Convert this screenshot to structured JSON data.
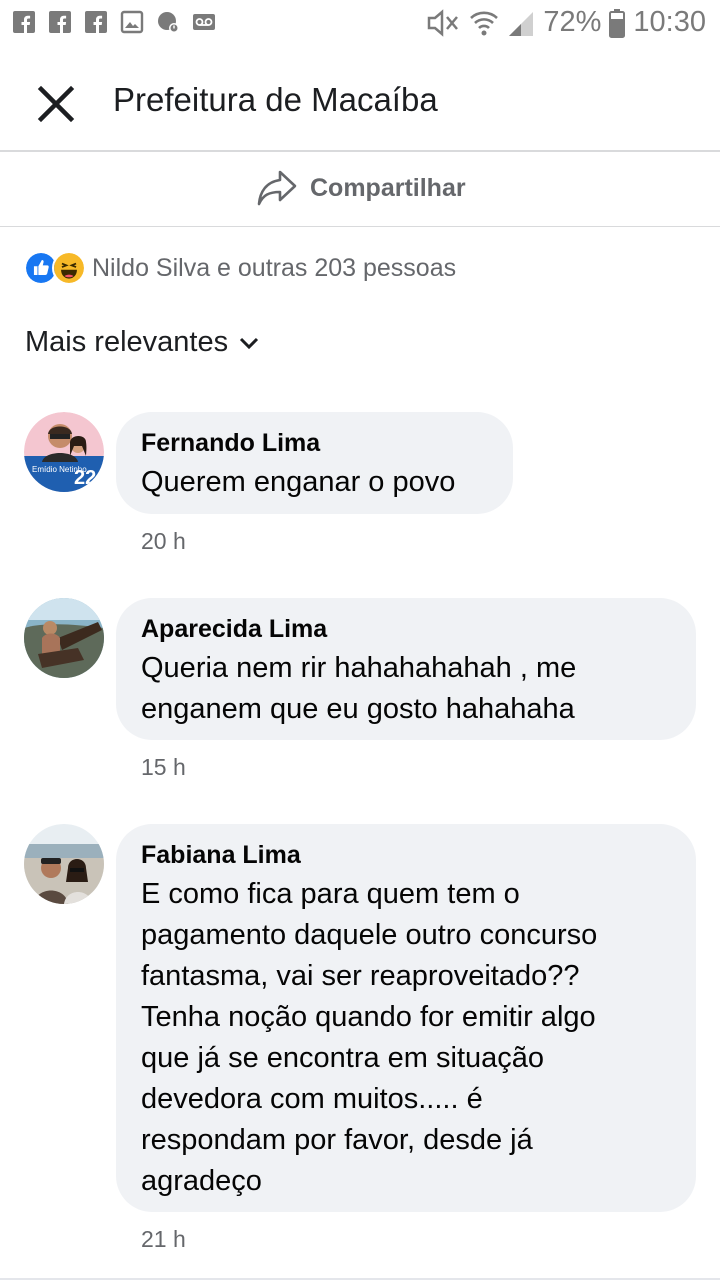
{
  "status_bar": {
    "battery": "72%",
    "time": "10:30",
    "left_icons": [
      "facebook-icon",
      "facebook-icon",
      "facebook-icon",
      "image-icon",
      "location-icon",
      "voicemail-icon"
    ],
    "right_icons": [
      "mute-icon",
      "wifi-icon",
      "signal-icon",
      "battery-icon"
    ]
  },
  "header": {
    "title": "Prefeitura de Macaíba",
    "close_icon": "close-icon"
  },
  "share": {
    "label": "Compartilhar",
    "icon": "share-icon"
  },
  "reactions": {
    "icons": [
      "like-icon",
      "haha-icon"
    ],
    "text": "Nildo Silva e outras 203 pessoas"
  },
  "sort": {
    "label": "Mais relevantes",
    "icon": "chevron-down-icon"
  },
  "comments": [
    {
      "author": "Fernando Lima",
      "text": "Querem enganar o povo",
      "time": "20 h",
      "avatar_badge": "Emídio Netinho",
      "avatar_number": "22"
    },
    {
      "author": "Aparecida Lima",
      "text": "Queria nem rir hahahahahah , me\nenganem que eu gosto hahahaha",
      "time": "15 h"
    },
    {
      "author": "Fabiana Lima",
      "text": "E como fica para quem tem o\npagamento daquele outro concurso\nfantasma, vai ser reaproveitado??\nTenha noção quando for emitir algo\nque já se encontra em situação\ndevedora com muitos..... é\nrespondam por favor, desde já\nagradeço",
      "time": "21 h"
    }
  ],
  "colors": {
    "secondary_text": "#65676b",
    "bubble_bg": "#f0f2f5",
    "like_blue": "#1877f2",
    "haha_yellow": "#f7b928"
  }
}
